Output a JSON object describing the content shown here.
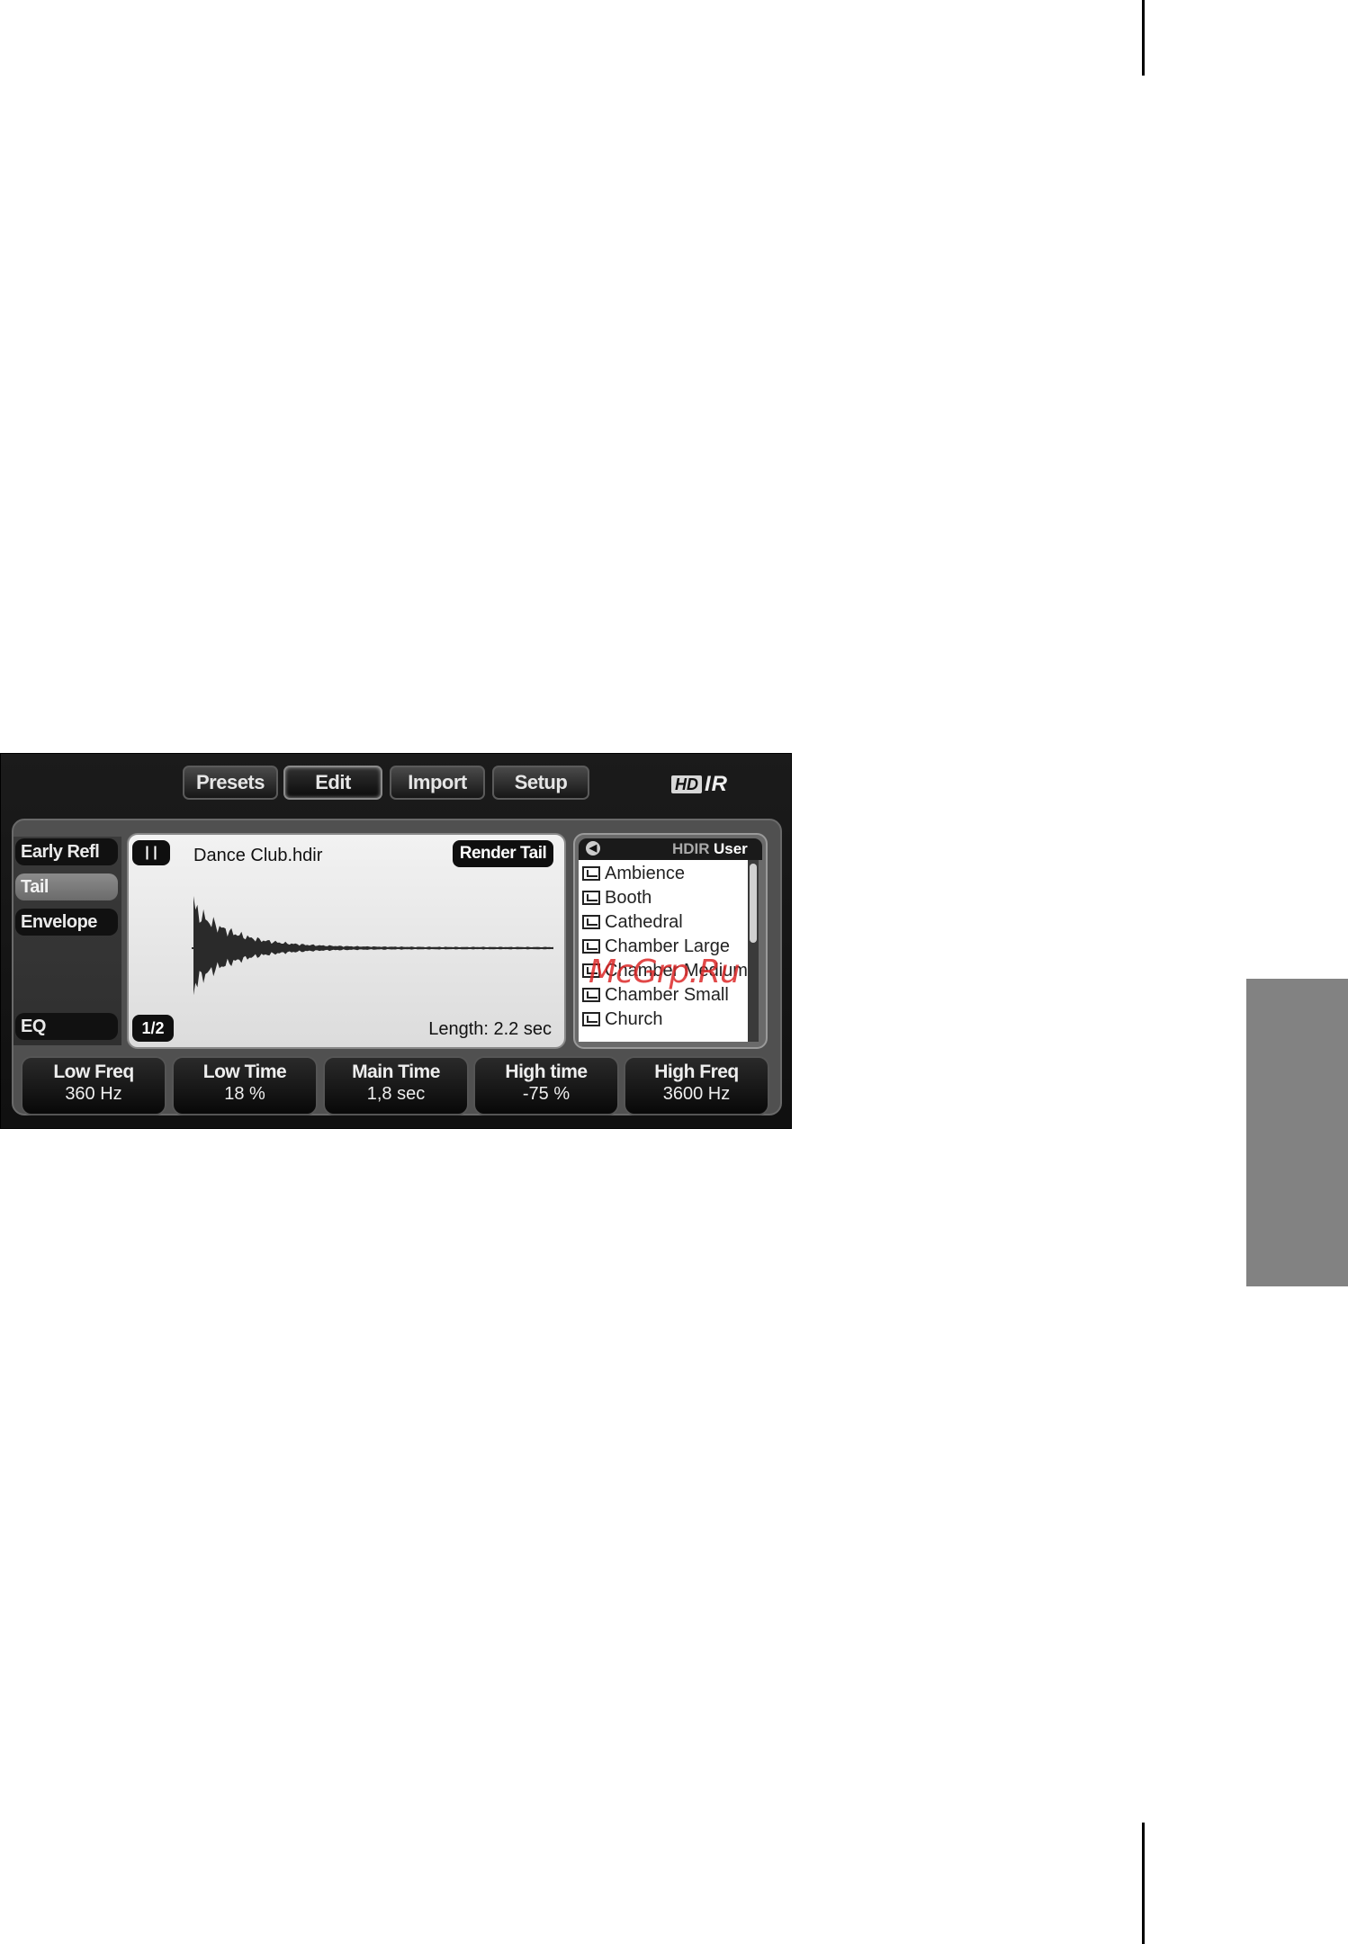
{
  "plugin": {
    "tabs": [
      {
        "label": "Presets"
      },
      {
        "label": "Edit",
        "active": true
      },
      {
        "label": "Import"
      },
      {
        "label": "Setup"
      }
    ],
    "logo": {
      "box": "HD",
      "text": "IR"
    },
    "sidebar": {
      "items": [
        {
          "label": "Early Refl"
        },
        {
          "label": "Tail",
          "active": true
        },
        {
          "label": "Envelope"
        },
        {
          "label": "EQ"
        }
      ]
    },
    "waveform": {
      "pause_label": "| |",
      "file_name": "Dance Club.hdir",
      "render_button": "Render Tail",
      "page_indicator": "1/2",
      "length": "Length: 2.2 sec"
    },
    "browser": {
      "header_main": "HDIR",
      "header_user": "User",
      "items": [
        "Ambience",
        "Booth",
        "Cathedral",
        "Chamber Large",
        "Chamber Medium",
        "Chamber Small",
        "Church"
      ],
      "scroll_fraction": 0.45
    },
    "knobs": [
      {
        "label": "Low Freq",
        "value": "360 Hz"
      },
      {
        "label": "Low Time",
        "value": "18 %"
      },
      {
        "label": "Main Time",
        "value": "1,8 sec"
      },
      {
        "label": "High time",
        "value": "-75 %"
      },
      {
        "label": "High Freq",
        "value": "3600 Hz"
      }
    ]
  },
  "watermark": "McGrp.Ru",
  "colors": {
    "side_tab": "#828282",
    "watermark": "#dc2828",
    "panel_bg": "#111111"
  }
}
